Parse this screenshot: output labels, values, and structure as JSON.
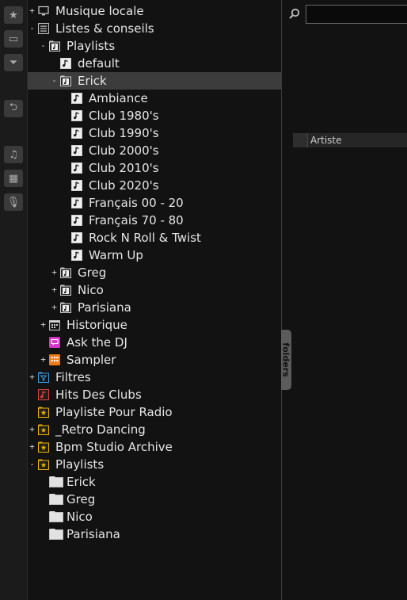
{
  "tree": [
    {
      "label": "Musique locale",
      "level": 0,
      "expander": "+",
      "icon": "monitor-icon"
    },
    {
      "label": "Listes & conseils",
      "level": 0,
      "expander": "-",
      "icon": "list-icon"
    },
    {
      "label": "Playlists",
      "level": 1,
      "expander": "-",
      "icon": "playlist-folder-icon"
    },
    {
      "label": "default",
      "level": 2,
      "expander": "",
      "icon": "playlist-icon"
    },
    {
      "label": "Erick",
      "level": 2,
      "expander": "-",
      "icon": "playlist-folder-icon",
      "selected": true
    },
    {
      "label": "Ambiance",
      "level": 3,
      "expander": "",
      "icon": "playlist-icon"
    },
    {
      "label": "Club 1980's",
      "level": 3,
      "expander": "",
      "icon": "playlist-icon"
    },
    {
      "label": "Club 1990's",
      "level": 3,
      "expander": "",
      "icon": "playlist-icon"
    },
    {
      "label": "Club 2000's",
      "level": 3,
      "expander": "",
      "icon": "playlist-icon"
    },
    {
      "label": "Club 2010's",
      "level": 3,
      "expander": "",
      "icon": "playlist-icon"
    },
    {
      "label": "Club 2020's",
      "level": 3,
      "expander": "",
      "icon": "playlist-icon"
    },
    {
      "label": "Français 00 - 20",
      "level": 3,
      "expander": "",
      "icon": "playlist-icon"
    },
    {
      "label": "Français 70 - 80",
      "level": 3,
      "expander": "",
      "icon": "playlist-icon"
    },
    {
      "label": "Rock N Roll & Twist",
      "level": 3,
      "expander": "",
      "icon": "playlist-icon"
    },
    {
      "label": "Warm Up",
      "level": 3,
      "expander": "",
      "icon": "playlist-icon"
    },
    {
      "label": "Greg",
      "level": 2,
      "expander": "+",
      "icon": "playlist-folder-icon"
    },
    {
      "label": "Nico",
      "level": 2,
      "expander": "+",
      "icon": "playlist-folder-icon"
    },
    {
      "label": "Parisiana",
      "level": 2,
      "expander": "+",
      "icon": "playlist-folder-icon"
    },
    {
      "label": "Historique",
      "level": 1,
      "expander": "+",
      "icon": "calendar-icon"
    },
    {
      "label": "Ask the DJ",
      "level": 1,
      "expander": "",
      "icon": "chat-icon"
    },
    {
      "label": "Sampler",
      "level": 1,
      "expander": "+",
      "icon": "sampler-grid-icon"
    },
    {
      "label": "Filtres",
      "level": 0,
      "expander": "+",
      "icon": "filter-folder-icon"
    },
    {
      "label": "Hits Des Clubs",
      "level": 0,
      "expander": "",
      "icon": "red-playlist-icon"
    },
    {
      "label": "Playliste Pour Radio",
      "level": 0,
      "expander": "",
      "icon": "star-folder-icon"
    },
    {
      "label": "_Retro Dancing",
      "level": 0,
      "expander": "+",
      "icon": "star-folder-icon"
    },
    {
      "label": "Bpm Studio Archive",
      "level": 0,
      "expander": "+",
      "icon": "star-folder-icon"
    },
    {
      "label": "Playlists",
      "level": 0,
      "expander": "-",
      "icon": "star-folder-icon"
    },
    {
      "label": "Erick",
      "level": 1,
      "expander": "",
      "icon": "folder-icon"
    },
    {
      "label": "Greg",
      "level": 1,
      "expander": "",
      "icon": "folder-icon"
    },
    {
      "label": "Nico",
      "level": 1,
      "expander": "",
      "icon": "folder-icon"
    },
    {
      "label": "Parisiana",
      "level": 1,
      "expander": "",
      "icon": "folder-icon"
    }
  ],
  "toolbar": [
    {
      "name": "favorites-star-button",
      "glyph": "★"
    },
    {
      "name": "folder-add-button",
      "glyph": "▭"
    },
    {
      "name": "filter-add-button",
      "glyph": "⏷"
    },
    {
      "name": "back-button",
      "glyph": "⮌"
    },
    {
      "name": "music-view-button",
      "glyph": "♫"
    },
    {
      "name": "video-view-button",
      "glyph": "▦"
    },
    {
      "name": "microphone-button",
      "glyph": "🎙"
    }
  ],
  "search": {
    "placeholder": "",
    "value": ""
  },
  "browser": {
    "column_header": "Artiste"
  },
  "side_tab": {
    "label": "folders"
  },
  "colors": {
    "selected": "#3c3c3c",
    "accent_orange": "#f07a16",
    "accent_magenta": "#d633c8",
    "accent_gold": "#f0b400",
    "accent_blue": "#3b9be0",
    "accent_red": "#e04040"
  }
}
